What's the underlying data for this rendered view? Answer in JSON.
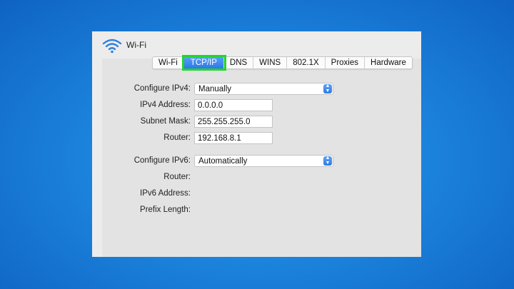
{
  "window": {
    "title": "Wi-Fi",
    "icon": "wifi-icon"
  },
  "tabs": [
    {
      "label": "Wi-Fi",
      "active": false
    },
    {
      "label": "TCP/IP",
      "active": true
    },
    {
      "label": "DNS",
      "active": false
    },
    {
      "label": "WINS",
      "active": false
    },
    {
      "label": "802.1X",
      "active": false
    },
    {
      "label": "Proxies",
      "active": false
    },
    {
      "label": "Hardware",
      "active": false
    }
  ],
  "ipv4": {
    "configure_label": "Configure IPv4:",
    "configure_value": "Manually",
    "address_label": "IPv4 Address:",
    "address_value": "0.0.0.0",
    "subnet_label": "Subnet Mask:",
    "subnet_value": "255.255.255.0",
    "router_label": "Router:",
    "router_value": "192.168.8.1"
  },
  "ipv6": {
    "configure_label": "Configure IPv6:",
    "configure_value": "Automatically",
    "router_label": "Router:",
    "address_label": "IPv6 Address:",
    "prefix_label": "Prefix Length:"
  },
  "colors": {
    "highlight": "#22d62c",
    "accent": "#2c78e8",
    "desktop": "#1c84dd"
  }
}
